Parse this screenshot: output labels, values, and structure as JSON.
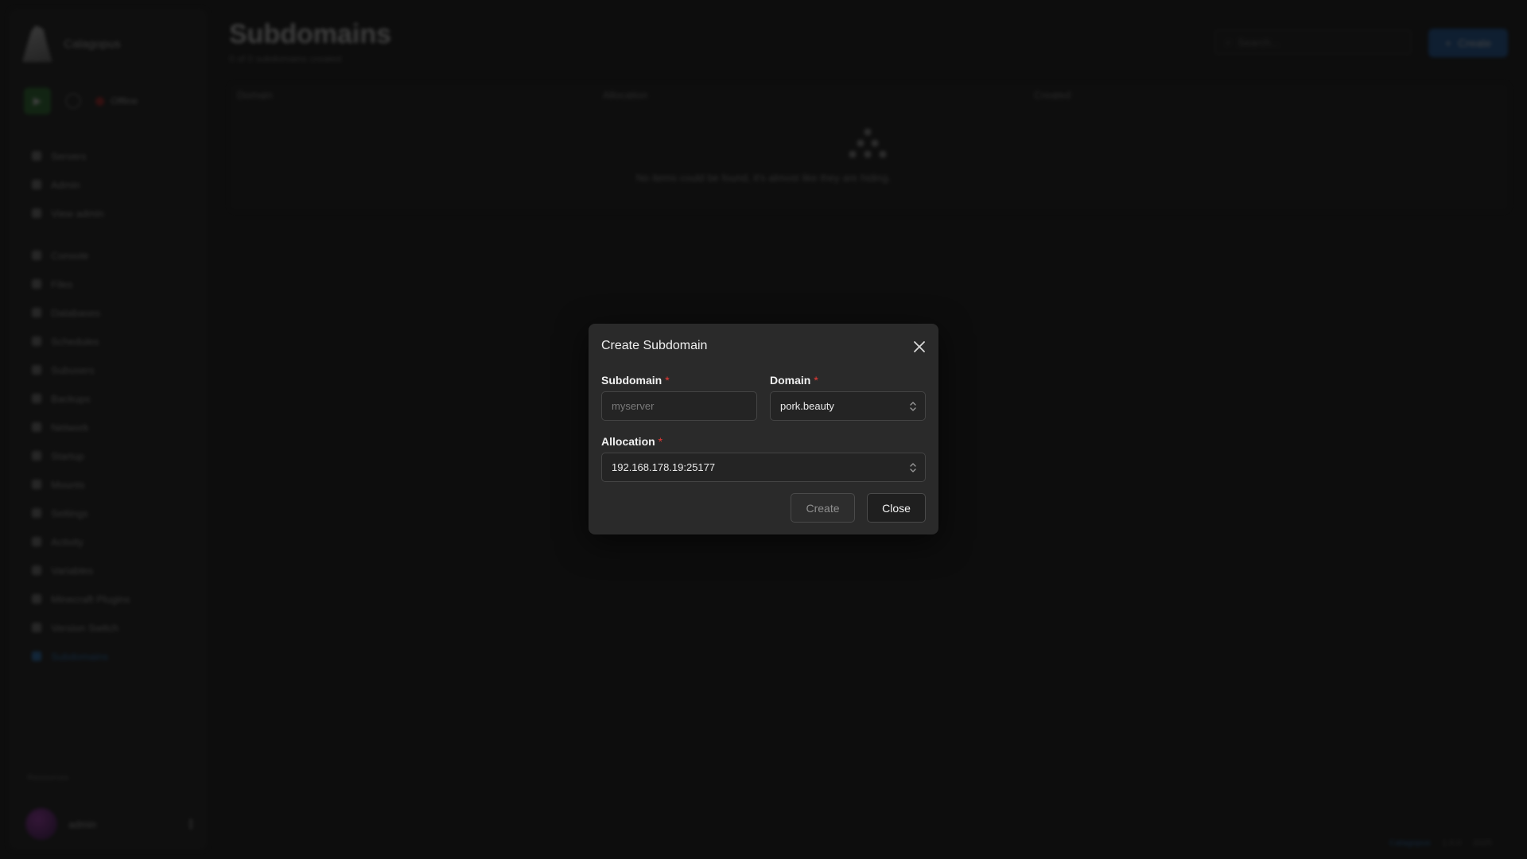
{
  "app": {
    "brand_name": "Calagopus",
    "status_label": "Offline",
    "nav_items": [
      "Servers",
      "Admin",
      "View admin",
      "Console",
      "Files",
      "Databases",
      "Schedules",
      "Subusers",
      "Backups",
      "Network",
      "Startup",
      "Mounts",
      "Settings",
      "Activity",
      "Variables",
      "Minecraft Plugins",
      "Version Switch",
      "Subdomains"
    ],
    "sidebar_section": "Resources",
    "user_name": "admin"
  },
  "page": {
    "title": "Subdomains",
    "subtitle": "0 of 0 subdomains created",
    "search_placeholder": "Search...",
    "create_label": "Create",
    "columns": [
      "Domain",
      "Allocation",
      "Created"
    ],
    "empty_text": "No items could be found, it's almost like they are hiding."
  },
  "footer": {
    "brand": "Calagopus",
    "items": [
      "1.0.0",
      "2025"
    ]
  },
  "modal": {
    "title": "Create Subdomain",
    "subdomain": {
      "label": "Subdomain",
      "placeholder": "myserver",
      "value": ""
    },
    "domain": {
      "label": "Domain",
      "value": "pork.beauty"
    },
    "allocation": {
      "label": "Allocation",
      "value": "192.168.178.19:25177"
    },
    "required_marker": "*",
    "create_button": "Create",
    "close_button": "Close"
  }
}
